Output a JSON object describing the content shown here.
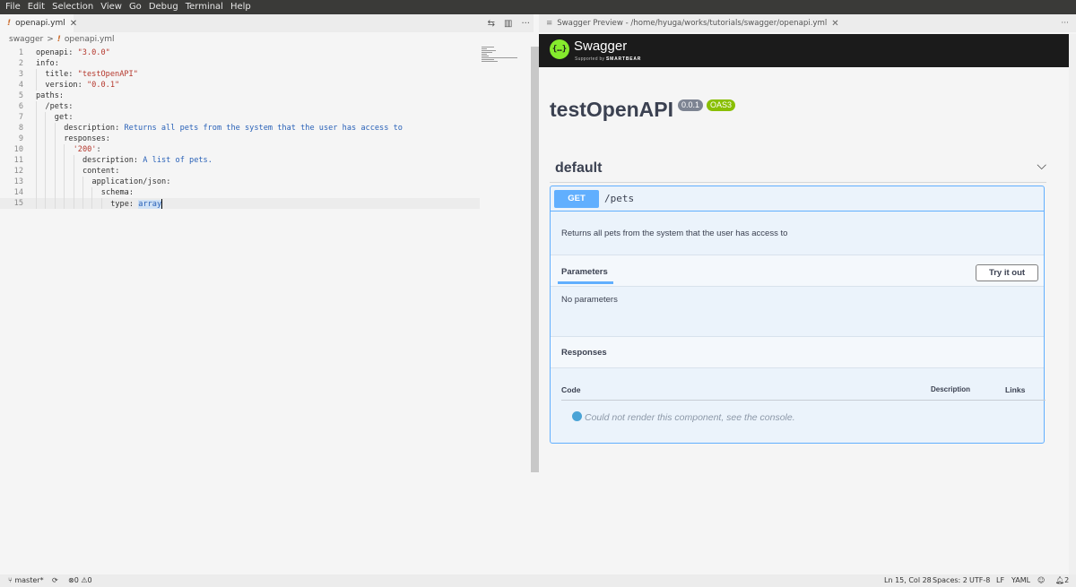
{
  "menu": [
    "File",
    "Edit",
    "Selection",
    "View",
    "Go",
    "Debug",
    "Terminal",
    "Help"
  ],
  "editor": {
    "tab": {
      "label": "openapi.yml",
      "close": "✕"
    },
    "actions": {
      "compare": "⇆",
      "split": "▥",
      "more": "···"
    },
    "breadcrumb": {
      "folder": "swagger",
      "sep": ">",
      "file": "openapi.yml"
    },
    "lines": [
      {
        "n": "1",
        "indent": 0,
        "key": "openapi",
        "val": "\"3.0.0\"",
        "type": "s"
      },
      {
        "n": "2",
        "indent": 0,
        "key": "info",
        "val": "",
        "type": ""
      },
      {
        "n": "3",
        "indent": 1,
        "key": "title",
        "val": "\"testOpenAPI\"",
        "type": "s"
      },
      {
        "n": "4",
        "indent": 1,
        "key": "version",
        "val": "\"0.0.1\"",
        "type": "s"
      },
      {
        "n": "5",
        "indent": 0,
        "key": "paths",
        "val": "",
        "type": ""
      },
      {
        "n": "6",
        "indent": 1,
        "key": "/pets",
        "val": "",
        "type": ""
      },
      {
        "n": "7",
        "indent": 2,
        "key": "get",
        "val": "",
        "type": ""
      },
      {
        "n": "8",
        "indent": 3,
        "key": "description",
        "val": "Returns all pets from the system that the user has access to",
        "type": "v"
      },
      {
        "n": "9",
        "indent": 3,
        "key": "responses",
        "val": "",
        "type": ""
      },
      {
        "n": "10",
        "indent": 4,
        "key": "'200'",
        "val": "",
        "type": "",
        "keyStr": true
      },
      {
        "n": "11",
        "indent": 5,
        "key": "description",
        "val": "A list of pets.",
        "type": "v"
      },
      {
        "n": "12",
        "indent": 5,
        "key": "content",
        "val": "",
        "type": ""
      },
      {
        "n": "13",
        "indent": 6,
        "key": "application/json",
        "val": "",
        "type": ""
      },
      {
        "n": "14",
        "indent": 7,
        "key": "schema",
        "val": "",
        "type": ""
      },
      {
        "n": "15",
        "indent": 8,
        "key": "type",
        "val": "array",
        "type": "v",
        "active": true
      }
    ]
  },
  "preview": {
    "tab": {
      "label": "Swagger Preview - /home/hyuga/works/tutorials/swagger/openapi.yml",
      "close": "✕",
      "icon": "≡"
    },
    "more": "···",
    "brand": {
      "logo": "{…}",
      "name": "Swagger",
      "supported": "Supported by",
      "company": "SMARTBEAR"
    },
    "title": "testOpenAPI",
    "version": "0.0.1",
    "oas": "OAS3",
    "tag": "default",
    "chevron": "⌵",
    "op": {
      "method": "GET",
      "path": "/pets",
      "description": "Returns all pets from the system that the user has access to",
      "parameters_label": "Parameters",
      "try_label": "Try it out",
      "no_params": "No parameters",
      "responses_label": "Responses",
      "col_code": "Code",
      "col_desc": "Description",
      "col_links": "Links",
      "error": "Could not render this component, see the console."
    }
  },
  "status": {
    "branch": "master*",
    "sync": "⟳",
    "errors": "0",
    "warnings": "0",
    "position": "Ln 15, Col 28",
    "spaces": "Spaces: 2",
    "encoding": "UTF-8",
    "eol": "LF",
    "language": "YAML",
    "feedback": "☺",
    "notifications": "2"
  }
}
